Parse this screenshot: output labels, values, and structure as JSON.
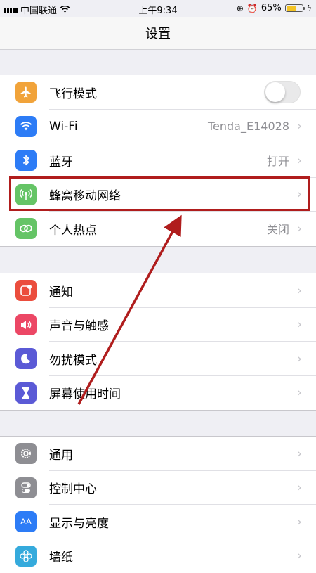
{
  "status": {
    "carrier": "中国联通",
    "time": "上午9:34",
    "battery": "65%",
    "battery_level": 0.65
  },
  "nav": {
    "title": "设置"
  },
  "groups": [
    {
      "items": [
        {
          "label": "飞行模式",
          "value": "",
          "icon": "airplane-icon",
          "color": "#f1a33a",
          "toggle": true,
          "toggle_on": false
        },
        {
          "label": "Wi-Fi",
          "value": "Tenda_E14028",
          "icon": "wifi-icon",
          "color": "#2d7cf6"
        },
        {
          "label": "蓝牙",
          "value": "打开",
          "icon": "bluetooth-icon",
          "color": "#2d7cf6"
        },
        {
          "label": "蜂窝移动网络",
          "value": "",
          "icon": "cellular-icon",
          "color": "#65c466"
        },
        {
          "label": "个人热点",
          "value": "关闭",
          "icon": "hotspot-icon",
          "color": "#65c466"
        }
      ]
    },
    {
      "items": [
        {
          "label": "通知",
          "icon": "notifications-icon",
          "color": "#eb4d3d"
        },
        {
          "label": "声音与触感",
          "icon": "sound-icon",
          "color": "#ec4765"
        },
        {
          "label": "勿扰模式",
          "icon": "moon-icon",
          "color": "#5b5ad6"
        },
        {
          "label": "屏幕使用时间",
          "icon": "hourglass-icon",
          "color": "#5b5ad6"
        }
      ]
    },
    {
      "items": [
        {
          "label": "通用",
          "icon": "gear-icon",
          "color": "#8e8e93"
        },
        {
          "label": "控制中心",
          "icon": "toggles-icon",
          "color": "#8e8e93"
        },
        {
          "label": "显示与亮度",
          "icon": "text-size-icon",
          "color": "#2d7cf6"
        },
        {
          "label": "墙纸",
          "icon": "wallpaper-icon",
          "color": "#35aadc"
        }
      ]
    }
  ],
  "annotation_color": "#b01d1d"
}
